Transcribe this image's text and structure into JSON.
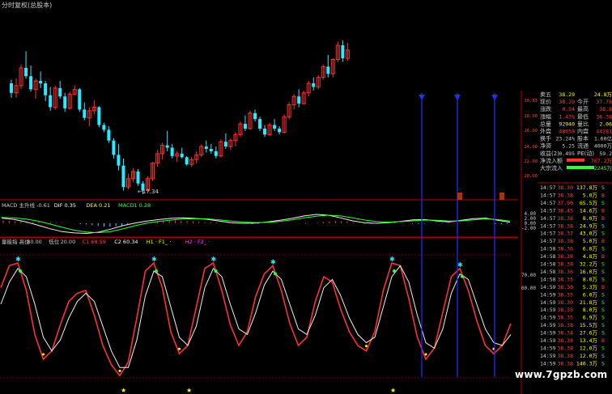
{
  "chart_data": [
    {
      "type": "candlestick",
      "title": "",
      "legend_text": "分时复权(总股本)",
      "low_annotation": "17.34",
      "colors": {
        "up": "#ff3030",
        "down": "#30e8ff",
        "bg": "#000000"
      },
      "ohlc": [
        [
          26.6,
          26.9,
          25.4,
          25.8
        ],
        [
          25.8,
          27.0,
          25.4,
          26.4
        ],
        [
          26.4,
          28.2,
          26.1,
          27.9
        ],
        [
          27.9,
          29.3,
          27.0,
          27.2
        ],
        [
          27.2,
          28.1,
          25.9,
          26.1
        ],
        [
          26.1,
          27.0,
          25.3,
          26.8
        ],
        [
          26.8,
          27.6,
          26.2,
          26.6
        ],
        [
          26.6,
          26.8,
          25.1,
          25.6
        ],
        [
          25.6,
          26.3,
          24.3,
          24.6
        ],
        [
          24.6,
          26.4,
          24.4,
          26.2
        ],
        [
          26.2,
          26.8,
          25.3,
          25.5
        ],
        [
          25.5,
          25.8,
          24.2,
          24.5
        ],
        [
          24.5,
          25.9,
          24.4,
          25.7
        ],
        [
          25.7,
          26.4,
          25.6,
          26.1
        ],
        [
          26.1,
          26.2,
          24.2,
          24.4
        ],
        [
          24.4,
          25.0,
          23.5,
          23.7
        ],
        [
          23.7,
          24.6,
          23.0,
          24.3
        ],
        [
          24.3,
          25.2,
          24.0,
          24.6
        ],
        [
          24.6,
          24.7,
          22.9,
          23.1
        ],
        [
          23.1,
          23.3,
          22.5,
          22.7
        ],
        [
          22.7,
          23.0,
          21.6,
          21.8
        ],
        [
          21.8,
          22.0,
          20.3,
          20.6
        ],
        [
          20.6,
          21.5,
          19.3,
          19.7
        ],
        [
          19.7,
          20.3,
          17.6,
          17.9
        ],
        [
          17.9,
          19.0,
          17.7,
          18.6
        ],
        [
          18.6,
          19.5,
          18.3,
          19.2
        ],
        [
          19.2,
          19.4,
          18.0,
          18.2
        ],
        [
          18.2,
          18.4,
          17.3,
          17.6
        ],
        [
          17.6,
          18.8,
          17.5,
          18.6
        ],
        [
          18.6,
          20.0,
          18.4,
          19.9
        ],
        [
          19.9,
          21.0,
          19.6,
          20.7
        ],
        [
          20.7,
          21.6,
          20.2,
          21.4
        ],
        [
          21.4,
          22.6,
          20.9,
          21.2
        ],
        [
          21.2,
          21.5,
          20.3,
          20.5
        ],
        [
          20.5,
          20.9,
          20.0,
          20.7
        ],
        [
          20.7,
          21.2,
          20.3,
          20.4
        ],
        [
          20.4,
          20.5,
          19.7,
          19.8
        ],
        [
          19.8,
          20.4,
          19.6,
          20.2
        ],
        [
          20.2,
          20.9,
          19.9,
          20.6
        ],
        [
          20.6,
          21.5,
          20.4,
          21.3
        ],
        [
          21.3,
          21.8,
          20.8,
          21.1
        ],
        [
          21.1,
          21.5,
          20.7,
          20.9
        ],
        [
          20.9,
          21.3,
          20.3,
          20.5
        ],
        [
          20.5,
          21.9,
          20.4,
          21.7
        ],
        [
          21.7,
          22.4,
          21.1,
          21.3
        ],
        [
          21.3,
          22.0,
          21.0,
          21.8
        ],
        [
          21.8,
          22.5,
          21.3,
          22.3
        ],
        [
          22.3,
          23.4,
          22.1,
          23.2
        ],
        [
          23.2,
          23.9,
          22.6,
          22.8
        ],
        [
          22.8,
          24.3,
          22.7,
          24.1
        ],
        [
          24.1,
          24.4,
          23.4,
          23.6
        ],
        [
          23.6,
          23.8,
          22.6,
          22.8
        ],
        [
          22.8,
          23.1,
          22.1,
          22.3
        ],
        [
          22.3,
          23.3,
          22.2,
          23.1
        ],
        [
          23.1,
          23.6,
          22.6,
          22.8
        ],
        [
          22.8,
          23.0,
          22.3,
          22.5
        ],
        [
          22.5,
          24.0,
          22.4,
          23.8
        ],
        [
          23.8,
          25.0,
          23.6,
          24.8
        ],
        [
          24.8,
          25.7,
          24.4,
          25.5
        ],
        [
          25.5,
          26.1,
          24.6,
          24.9
        ],
        [
          24.9,
          26.0,
          24.8,
          25.8
        ],
        [
          25.8,
          26.8,
          25.5,
          26.6
        ],
        [
          26.6,
          27.1,
          26.0,
          26.3
        ],
        [
          26.3,
          27.3,
          26.1,
          27.1
        ],
        [
          27.1,
          28.2,
          26.9,
          28.0
        ],
        [
          28.0,
          29.0,
          27.1,
          27.4
        ],
        [
          27.4,
          28.7,
          27.1,
          28.6
        ],
        [
          28.6,
          30.1,
          28.4,
          29.8
        ],
        [
          29.8,
          30.2,
          28.4,
          28.7
        ],
        [
          28.7,
          30.0,
          28.5,
          29.4
        ]
      ]
    },
    {
      "type": "line",
      "title": "MACD",
      "header_items": [
        {
          "text": "MACD 主升线 -0.61",
          "color": "#cccccc"
        },
        {
          "text": "DIF 0.35",
          "color": "#ffffff"
        },
        {
          "text": "DEA 0.21",
          "color": "#ffff00"
        },
        {
          "text": "MACD1 0.28",
          "color": "#30ff30"
        }
      ],
      "yticks": [
        "4.00",
        "2.00",
        "0.00",
        "-2.00"
      ],
      "series": [
        {
          "name": "DIF",
          "color": "#f0f0f0",
          "values": [
            2.1,
            1.6,
            0.6,
            -0.8,
            -2.2,
            -3.4,
            -3.9,
            -4.1,
            -3.6,
            -2.4,
            -1.0,
            0.1,
            0.9,
            1.5,
            2.0,
            2.2,
            2.0,
            1.6,
            0.9,
            0.2,
            0.0,
            0.1,
            0.6,
            1.2,
            2.0,
            3.0,
            3.6,
            3.3,
            2.2,
            1.0,
            0.2,
            0.0,
            0.3,
            0.8,
            1.4,
            1.5,
            0.9,
            0.6,
            1.2,
            1.9,
            2.1,
            1.2,
            0.4
          ]
        },
        {
          "name": "DEA",
          "color": "#30ff30",
          "values": [
            2.4,
            2.2,
            1.7,
            0.9,
            -0.3,
            -1.6,
            -2.8,
            -3.5,
            -3.8,
            -3.4,
            -2.3,
            -1.0,
            0.1,
            0.8,
            1.3,
            1.7,
            1.9,
            1.8,
            1.4,
            0.9,
            0.5,
            0.3,
            0.4,
            0.8,
            1.4,
            2.2,
            2.9,
            3.3,
            3.0,
            2.2,
            1.3,
            0.7,
            0.5,
            0.7,
            1.0,
            1.3,
            1.2,
            0.9,
            1.0,
            1.4,
            1.8,
            1.5,
            0.9
          ]
        }
      ],
      "histogram": [
        1.2,
        1.1,
        0.9,
        0.8,
        0.7,
        0.5,
        0.6,
        0.5,
        0.4,
        0.3,
        0.2,
        0.1,
        -0.1,
        -0.3,
        -0.5,
        -0.8,
        -1.1,
        -1.3,
        -1.4,
        -1.2,
        -0.9,
        -0.5,
        -0.2,
        0.1,
        0.3,
        0.6,
        0.8,
        1.0,
        1.1,
        1.2,
        1.1,
        1.0,
        0.9,
        0.7,
        0.5,
        0.4,
        0.3,
        0.2,
        0.2,
        0.1,
        0.0,
        -0.1,
        -0.3,
        -0.2,
        0.1,
        0.2,
        0.3,
        0.2,
        0.1,
        0.0,
        -0.1,
        -0.2,
        0.1,
        0.3,
        0.6,
        0.8,
        1.0,
        0.9,
        0.7,
        0.4,
        0.1,
        -0.1,
        -0.2,
        0.0,
        0.2,
        0.3,
        0.4,
        0.2,
        0.0,
        -0.2,
        -0.3,
        -0.2,
        0.1,
        0.2,
        0.3,
        0.4,
        0.3,
        0.2,
        0.0,
        -0.1,
        0.0,
        0.1,
        -0.1,
        -0.3,
        -0.4,
        -0.3
      ]
    },
    {
      "type": "line",
      "title": "量能指标",
      "header_items": [
        {
          "text": "量能指 高位",
          "color": "#cccccc"
        },
        {
          "text": "80.00",
          "color": "#cccccc"
        },
        {
          "text": "低位",
          "color": "#cccccc"
        },
        {
          "text": "20.00",
          "color": "#cccccc"
        },
        {
          "text": "C1 69.59",
          "color": "#ff4040"
        },
        {
          "text": "C2 60.34",
          "color": "#ffffff"
        },
        {
          "text": "H1 · F1_ ·",
          "color": "#ffff00"
        },
        {
          "text": "H2 · F2_ ·",
          "color": "#ff40ff"
        }
      ],
      "yticks": [
        "70.00",
        "60.00"
      ],
      "series": [
        {
          "name": "C1",
          "color": "#ff3030",
          "values": [
            72,
            88,
            90,
            70,
            38,
            20,
            26,
            45,
            62,
            68,
            70,
            52,
            30,
            16,
            8,
            18,
            50,
            84,
            90,
            72,
            40,
            24,
            30,
            58,
            86,
            90,
            70,
            45,
            30,
            40,
            66,
            82,
            88,
            70,
            46,
            30,
            36,
            62,
            80,
            76,
            56,
            40,
            30,
            26,
            40,
            70,
            90,
            88,
            64,
            36,
            20,
            28,
            54,
            80,
            86,
            70,
            48,
            30,
            24,
            30,
            46
          ]
        },
        {
          "name": "C2",
          "color": "#f0f0f0",
          "values": [
            60,
            76,
            86,
            80,
            60,
            36,
            26,
            34,
            50,
            62,
            68,
            62,
            44,
            26,
            14,
            14,
            34,
            66,
            84,
            80,
            58,
            36,
            30,
            44,
            72,
            86,
            80,
            60,
            42,
            38,
            54,
            74,
            84,
            78,
            60,
            42,
            38,
            52,
            72,
            78,
            66,
            50,
            38,
            32,
            36,
            58,
            80,
            88,
            76,
            52,
            32,
            28,
            42,
            68,
            82,
            78,
            60,
            42,
            32,
            30,
            38
          ]
        }
      ]
    }
  ],
  "quote_panel": {
    "rows": [
      {
        "l1": "卖五",
        "v1": "38.29",
        "r1": "",
        "rv": "24.8万",
        "c": "#ffff00"
      },
      {
        "l1": "现价",
        "v1": "38.29",
        "r1": "今开",
        "rv": "37.78",
        "c": "#ff4040"
      },
      {
        "l1": "涨跌",
        "v1": "0.54",
        "r1": "最高",
        "rv": "38.8",
        "c": "#ff4040"
      },
      {
        "l1": "涨幅",
        "v1": "1.43%",
        "r1": "最低",
        "rv": "36.38",
        "c": "#ff4040"
      },
      {
        "l1": "总量",
        "v1": "92940",
        "r1": "量比",
        "rv": "2.06",
        "c": "#ffff00"
      },
      {
        "l1": "外盘",
        "v1": "48659",
        "r1": "内盘",
        "rv": "44281",
        "c": "#ff4040"
      },
      {
        "l1": "换手",
        "v1": "23.24%",
        "r1": "股本",
        "rv": "1.60亿",
        "c": "#cccccc"
      },
      {
        "l1": "净资",
        "v1": "5.25",
        "r1": "流通",
        "rv": "4000万",
        "c": "#cccccc"
      },
      {
        "l1": "收益(2)",
        "v1": "0.495",
        "r1": "PE(动)",
        "rv": "59.2",
        "c": "#cccccc"
      },
      {
        "l1": "净流入额",
        "v1": "",
        "r1": "",
        "rv": "767.2万",
        "c": "#ff4040"
      },
      {
        "l1": "大宗流入",
        "v1": "",
        "r1": "",
        "rv": "-2245万",
        "c": "#30ff30"
      }
    ],
    "axis_ticks": [
      "30.83",
      "28.00",
      "26.00",
      "24.00",
      "22.00",
      "20.00"
    ]
  },
  "ticks": [
    {
      "time": "14:57",
      "price": "38.30",
      "vol": "137.8万",
      "bs": "S"
    },
    {
      "time": "14:57",
      "price": "38.38",
      "vol": "5.0万",
      "bs": "B"
    },
    {
      "time": "14:57",
      "price": "37.90",
      "vol": "65.5万",
      "bs": "S"
    },
    {
      "time": "14:57",
      "price": "38.45",
      "vol": "14.6万",
      "bs": "B"
    },
    {
      "time": "14:57",
      "price": "38.38",
      "vol": "8.0万",
      "bs": "B"
    },
    {
      "time": "14:57",
      "price": "38.38",
      "vol": "24.9万",
      "bs": "S"
    },
    {
      "time": "14:57",
      "price": "38.37",
      "vol": "43.0万",
      "bs": "S"
    },
    {
      "time": "14:57",
      "price": "38.38",
      "vol": "5.0万",
      "bs": "B"
    },
    {
      "time": "14:58",
      "price": "38.36",
      "vol": "6.0万",
      "bs": "S"
    },
    {
      "time": "14:58",
      "price": "38.38",
      "vol": "4.8万",
      "bs": "B"
    },
    {
      "time": "14:58",
      "price": "38.38",
      "vol": "32.2万",
      "bs": "S"
    },
    {
      "time": "14:58",
      "price": "38.36",
      "vol": "16.0万",
      "bs": "S"
    },
    {
      "time": "14:58",
      "price": "38.35",
      "vol": "8.0万",
      "bs": "S"
    },
    {
      "time": "14:59",
      "price": "38.30",
      "vol": "5.3万",
      "bs": "B"
    },
    {
      "time": "14:59",
      "price": "38.35",
      "vol": "6.0万",
      "bs": "S"
    },
    {
      "time": "14:59",
      "price": "38.30",
      "vol": "21.8万",
      "bs": "S"
    },
    {
      "time": "14:59",
      "price": "38.35",
      "vol": "8.0万",
      "bs": "S"
    },
    {
      "time": "14:59",
      "price": "38.35",
      "vol": "6.9万",
      "bs": "S"
    },
    {
      "time": "14:59",
      "price": "38.38",
      "vol": "15.5万",
      "bs": "S"
    },
    {
      "time": "14:59",
      "price": "38.34",
      "vol": "27.6万",
      "bs": "S"
    },
    {
      "time": "14:59",
      "price": "38.38",
      "vol": "13.4万",
      "bs": "B"
    },
    {
      "time": "14:59",
      "price": "38.38",
      "vol": "12.0万",
      "bs": "S"
    },
    {
      "time": "14:59",
      "price": "38.38",
      "vol": "12.0万",
      "bs": "S"
    },
    {
      "time": "14:59",
      "price": "38.38",
      "vol": "140.3万",
      "bs": "S"
    }
  ],
  "watermark": "www.7gpzb.com"
}
